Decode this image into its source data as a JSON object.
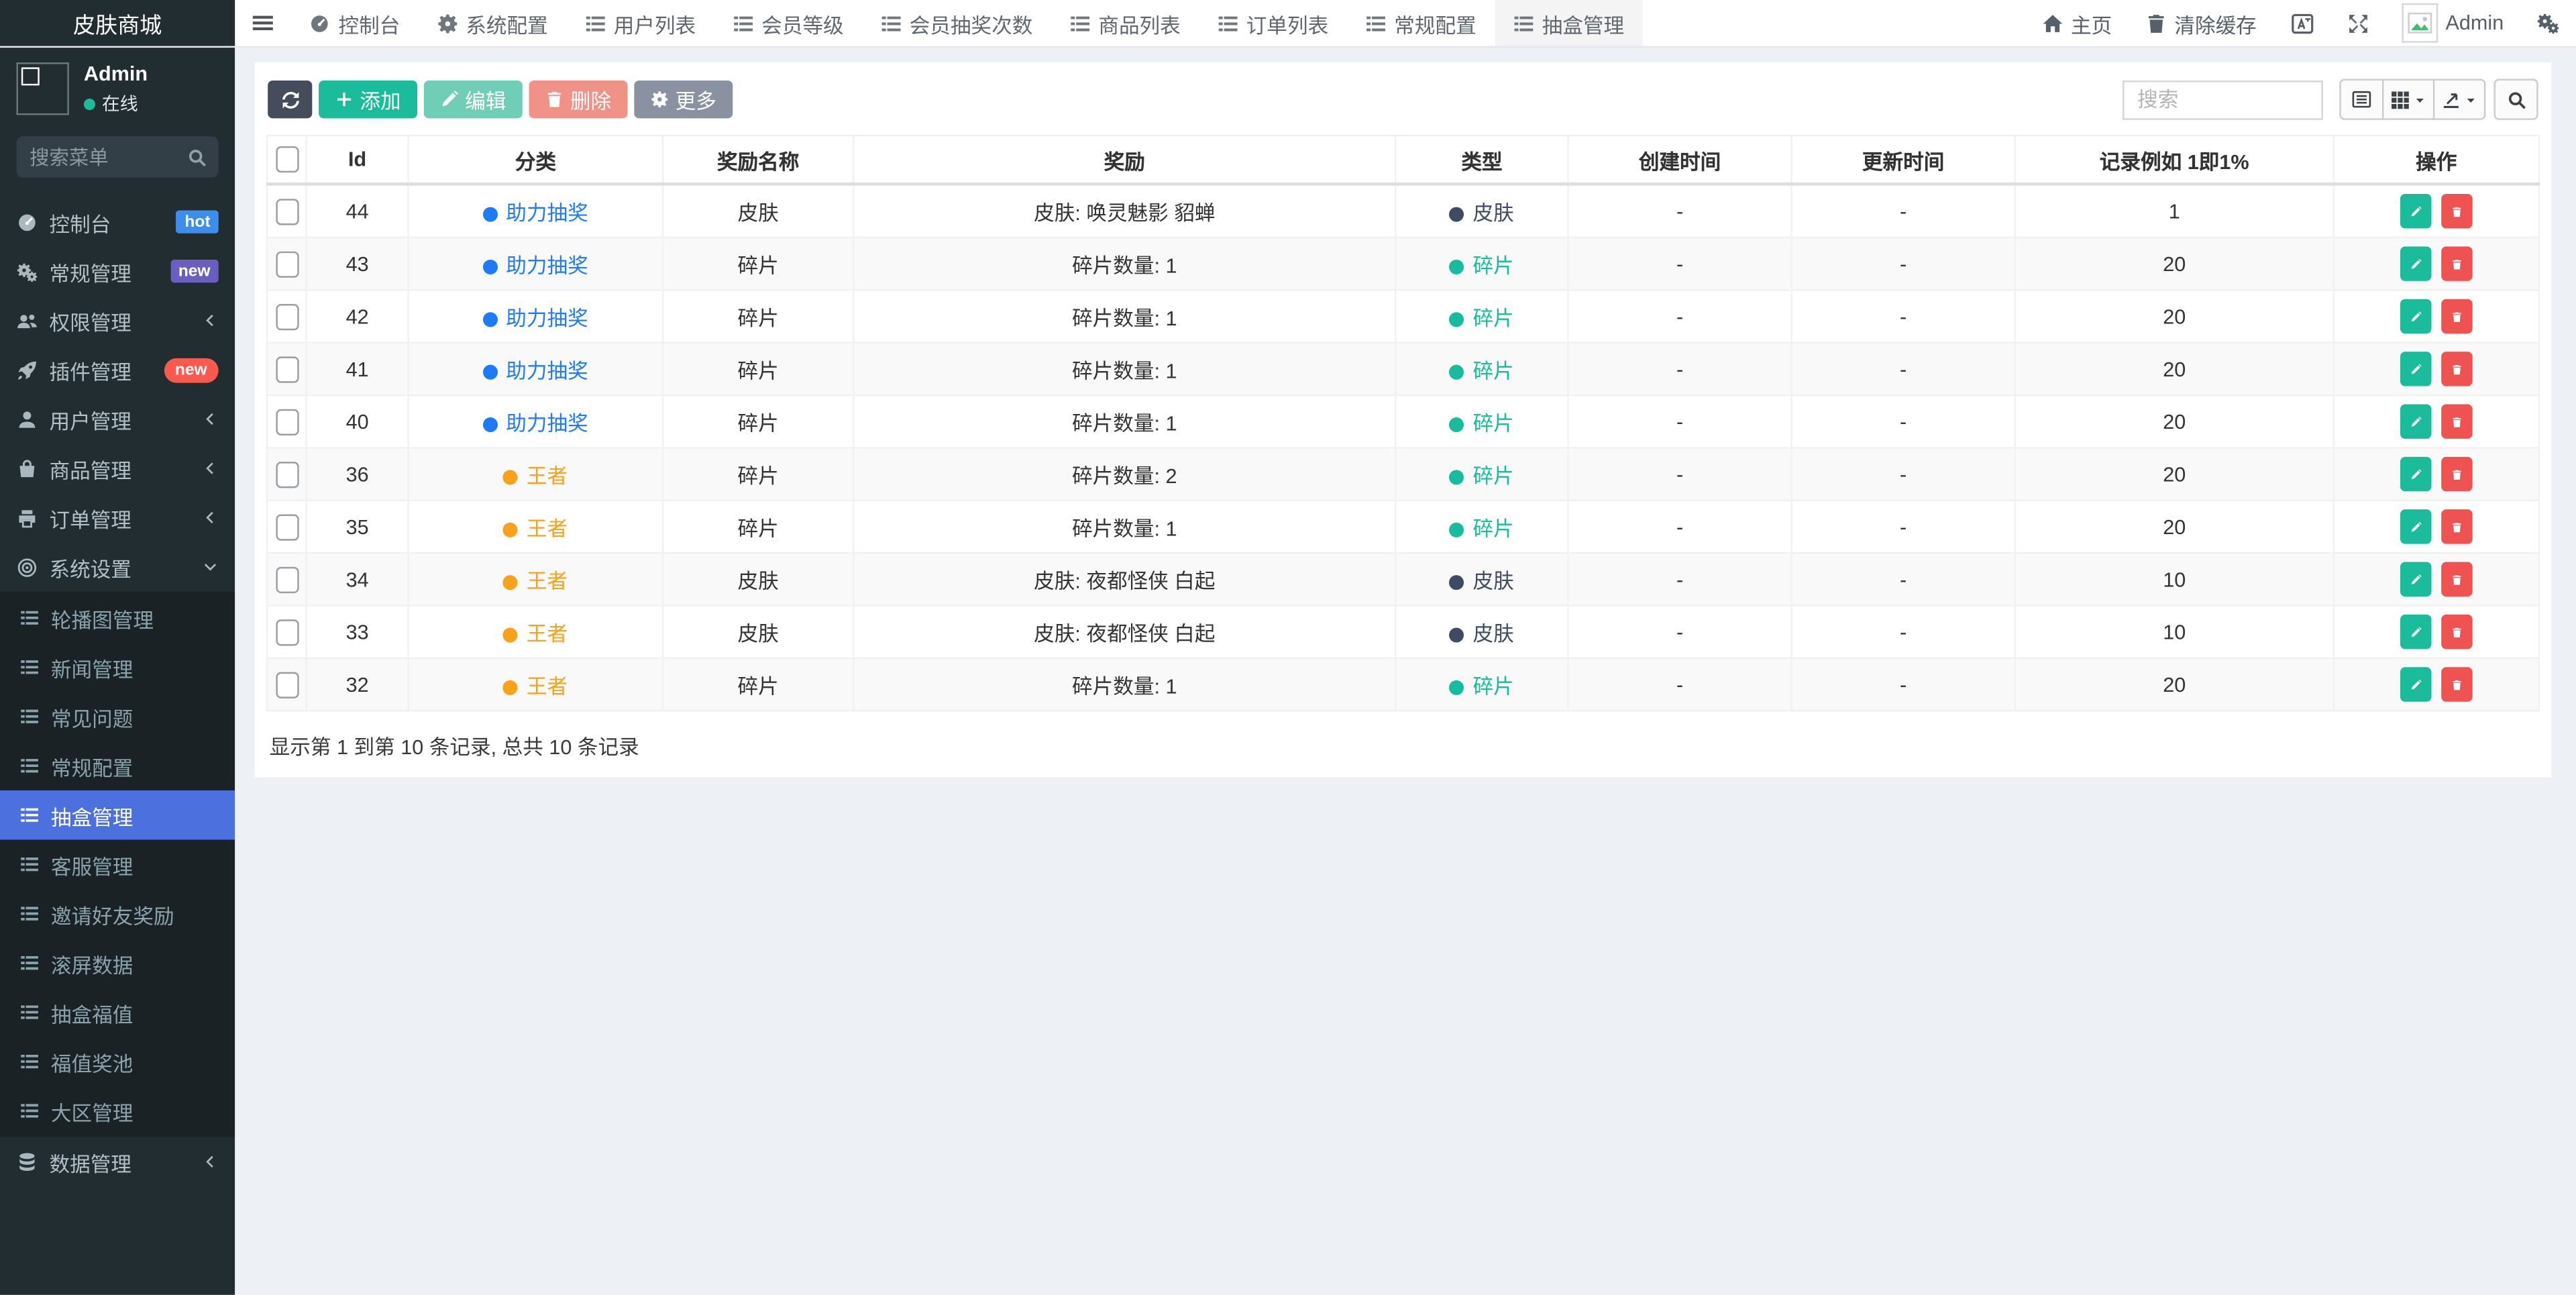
{
  "brand": {
    "title": "皮肤商城"
  },
  "topnav": {
    "tabs": [
      {
        "label": "控制台",
        "icon": "gauge"
      },
      {
        "label": "系统配置",
        "icon": "gear"
      },
      {
        "label": "用户列表",
        "icon": "thlist"
      },
      {
        "label": "会员等级",
        "icon": "thlist"
      },
      {
        "label": "会员抽奖次数",
        "icon": "thlist"
      },
      {
        "label": "商品列表",
        "icon": "thlist"
      },
      {
        "label": "订单列表",
        "icon": "thlist"
      },
      {
        "label": "常规配置",
        "icon": "thlist"
      },
      {
        "label": "抽盒管理",
        "icon": "thlist",
        "active": true
      }
    ],
    "right": {
      "home_label": "主页",
      "clear_cache_label": "清除缓存",
      "username": "Admin"
    }
  },
  "sidebar": {
    "user": {
      "name": "Admin",
      "status": "在线",
      "status_color": "#1abc9c"
    },
    "search_placeholder": "搜索菜单",
    "menu": [
      {
        "label": "控制台",
        "icon": "gauge",
        "badge": "hot",
        "badge_color": "#3c8dec"
      },
      {
        "label": "常规管理",
        "icon": "gears",
        "badge": "new",
        "badge_color": "#6a5fc1"
      },
      {
        "label": "权限管理",
        "icon": "users",
        "chevron": "chev-left"
      },
      {
        "label": "插件管理",
        "icon": "rocket",
        "badge": "new",
        "badge_color": "#fa5a4e",
        "badge_pill": true
      },
      {
        "label": "用户管理",
        "icon": "user",
        "chevron": "chev-left"
      },
      {
        "label": "商品管理",
        "icon": "bag",
        "chevron": "chev-left"
      },
      {
        "label": "订单管理",
        "icon": "print",
        "chevron": "chev-left"
      },
      {
        "label": "系统设置",
        "icon": "bullseye",
        "chevron": "chev-down",
        "open": true
      }
    ],
    "submenu": [
      {
        "label": "轮播图管理"
      },
      {
        "label": "新闻管理"
      },
      {
        "label": "常见问题"
      },
      {
        "label": "常规配置"
      },
      {
        "label": "抽盒管理",
        "active": true
      },
      {
        "label": "客服管理"
      },
      {
        "label": "邀请好友奖励"
      },
      {
        "label": "滚屏数据"
      },
      {
        "label": "抽盒福值"
      },
      {
        "label": "福值奖池"
      },
      {
        "label": "大区管理"
      }
    ],
    "menu_bottom": [
      {
        "label": "数据管理",
        "icon": "db",
        "chevron": "chev-left"
      }
    ],
    "active_color": "#4c70dd"
  },
  "toolbar": {
    "add_label": "添加",
    "edit_label": "编辑",
    "delete_label": "删除",
    "more_label": "更多",
    "search_placeholder": "搜索"
  },
  "table": {
    "columns": [
      "Id",
      "分类",
      "奖励名称",
      "奖励",
      "类型",
      "创建时间",
      "更新时间",
      "记录例如 1即1%",
      "操作"
    ],
    "rows": [
      {
        "id": "44",
        "category": "助力抽奖",
        "category_color": "#1e7bf7",
        "name": "皮肤",
        "reward": "皮肤: 唤灵魅影 貂蝉",
        "type": "皮肤",
        "type_color": "#3d4c63",
        "created": "-",
        "updated": "-",
        "record": "1"
      },
      {
        "id": "43",
        "category": "助力抽奖",
        "category_color": "#1e7bf7",
        "name": "碎片",
        "reward": "碎片数量: 1",
        "type": "碎片",
        "type_color": "#18bc9c",
        "created": "-",
        "updated": "-",
        "record": "20"
      },
      {
        "id": "42",
        "category": "助力抽奖",
        "category_color": "#1e7bf7",
        "name": "碎片",
        "reward": "碎片数量: 1",
        "type": "碎片",
        "type_color": "#18bc9c",
        "created": "-",
        "updated": "-",
        "record": "20"
      },
      {
        "id": "41",
        "category": "助力抽奖",
        "category_color": "#1e7bf7",
        "name": "碎片",
        "reward": "碎片数量: 1",
        "type": "碎片",
        "type_color": "#18bc9c",
        "created": "-",
        "updated": "-",
        "record": "20"
      },
      {
        "id": "40",
        "category": "助力抽奖",
        "category_color": "#1e7bf7",
        "name": "碎片",
        "reward": "碎片数量: 1",
        "type": "碎片",
        "type_color": "#18bc9c",
        "created": "-",
        "updated": "-",
        "record": "20"
      },
      {
        "id": "36",
        "category": "王者",
        "category_color": "#f6a21c",
        "name": "碎片",
        "reward": "碎片数量: 2",
        "type": "碎片",
        "type_color": "#18bc9c",
        "created": "-",
        "updated": "-",
        "record": "20"
      },
      {
        "id": "35",
        "category": "王者",
        "category_color": "#f6a21c",
        "name": "碎片",
        "reward": "碎片数量: 1",
        "type": "碎片",
        "type_color": "#18bc9c",
        "created": "-",
        "updated": "-",
        "record": "20"
      },
      {
        "id": "34",
        "category": "王者",
        "category_color": "#f6a21c",
        "name": "皮肤",
        "reward": "皮肤: 夜都怪侠 白起",
        "type": "皮肤",
        "type_color": "#3d4c63",
        "created": "-",
        "updated": "-",
        "record": "10"
      },
      {
        "id": "33",
        "category": "王者",
        "category_color": "#f6a21c",
        "name": "皮肤",
        "reward": "皮肤: 夜都怪侠 白起",
        "type": "皮肤",
        "type_color": "#3d4c63",
        "created": "-",
        "updated": "-",
        "record": "10"
      },
      {
        "id": "32",
        "category": "王者",
        "category_color": "#f6a21c",
        "name": "碎片",
        "reward": "碎片数量: 1",
        "type": "碎片",
        "type_color": "#18bc9c",
        "created": "-",
        "updated": "-",
        "record": "20"
      }
    ]
  },
  "footer": {
    "summary": "显示第 1 到第 10 条记录, 总共 10 条记录"
  }
}
